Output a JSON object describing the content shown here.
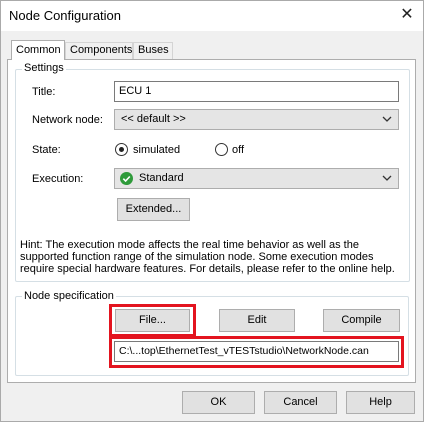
{
  "window": {
    "title": "Node Configuration",
    "close_glyph": "✕"
  },
  "tabs": [
    {
      "label": "Common",
      "active": true
    },
    {
      "label": "Components",
      "active": false
    },
    {
      "label": "Buses",
      "active": false
    }
  ],
  "settings": {
    "group_label": "Settings",
    "title_label": "Title:",
    "title_value": "ECU 1",
    "network_node_label": "Network node:",
    "network_node_value": "<< default >>",
    "state_label": "State:",
    "state_options": [
      {
        "label": "simulated",
        "selected": true
      },
      {
        "label": "off",
        "selected": false
      }
    ],
    "execution_label": "Execution:",
    "execution_value": "Standard",
    "execution_icon": "check-circle-icon",
    "extended_button": "Extended...",
    "hint": "Hint: The execution mode affects the real time behavior as well as the supported function range of the simulation node. Some execution modes require special hardware features. For details, please refer to the online help."
  },
  "node_spec": {
    "group_label": "Node specification",
    "file_button": "File...",
    "edit_button": "Edit",
    "compile_button": "Compile",
    "path_value": "C:\\...top\\EthernetTest_vTESTstudio\\NetworkNode.can"
  },
  "footer": {
    "ok_button": "OK",
    "cancel_button": "Cancel",
    "help_button": "Help"
  },
  "colors": {
    "highlight": "#e3141f",
    "check": "#2e9a3a"
  }
}
